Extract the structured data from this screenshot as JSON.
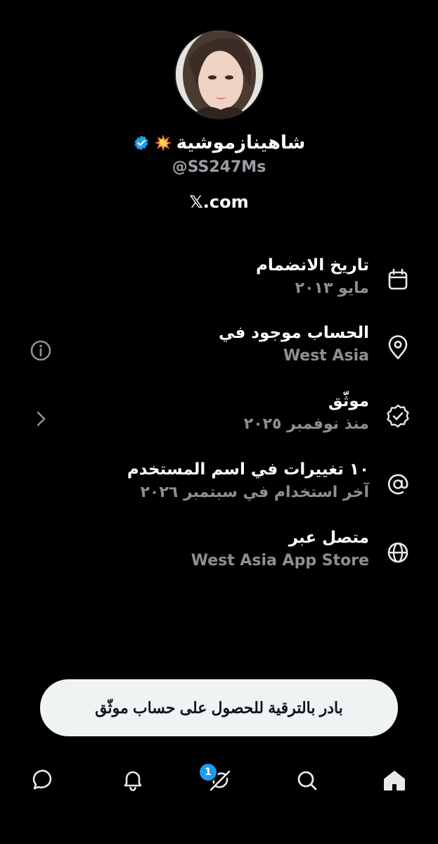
{
  "profile": {
    "display_name": "شاهينازموشية",
    "handle": "@SS247Ms",
    "site": "𝕏.com"
  },
  "rows": [
    {
      "icon": "calendar-icon",
      "title": "تاريخ الانضمام",
      "subtitle": "مايو ٢٠١٣"
    },
    {
      "icon": "location-pin-icon",
      "title": "الحساب موجود في",
      "subtitle": "West Asia",
      "left_icon": "info-icon"
    },
    {
      "icon": "verified-badge-icon",
      "title": "موثّق",
      "subtitle": "منذ نوفمبر ٢٠٢٥",
      "left_icon": "chevron-left-icon"
    },
    {
      "icon": "at-sign-icon",
      "title": "١٠ تغييرات في اسم المستخدم",
      "subtitle": "آخر استخدام في سبتمبر ٢٠٢٦"
    },
    {
      "icon": "globe-icon",
      "title": "متصل عبر",
      "subtitle": "West Asia App Store"
    }
  ],
  "upgrade_button": {
    "label": "بادر بالترقية للحصول على حساب موثّق"
  },
  "tabbar": {
    "items": [
      "messages-icon",
      "notifications-icon",
      "grok-icon",
      "search-icon",
      "home-icon"
    ],
    "grok_badge": "1"
  },
  "colors": {
    "background": "#000000",
    "accent": "#1d9bf0",
    "text_primary": "#ffffff",
    "text_secondary": "#8b9095",
    "button_bg": "#eff3f4"
  }
}
